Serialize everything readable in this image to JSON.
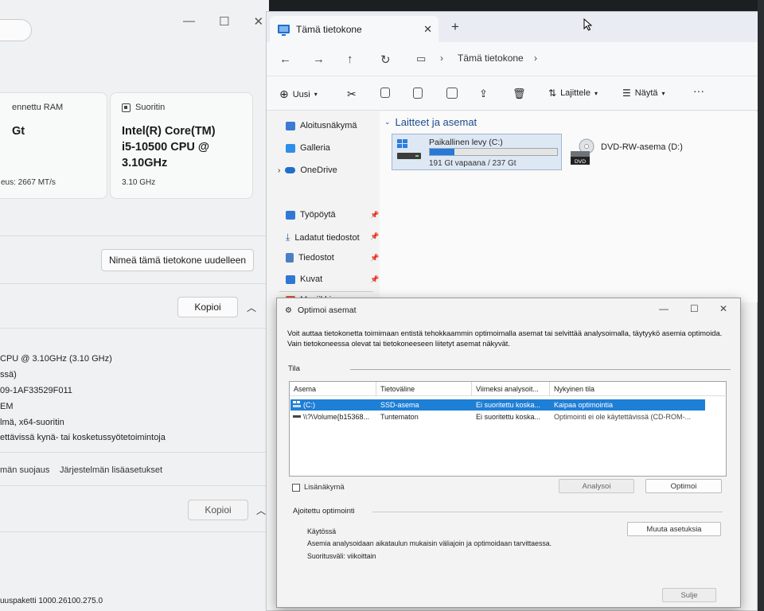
{
  "settings": {
    "ram_card": {
      "label": "ennettu RAM",
      "value": "Gt",
      "sub": "eus: 2667 MT/s"
    },
    "cpu_card": {
      "label": "Suoritin",
      "value_line1": "Intel(R) Core(TM)",
      "value_line2": "i5-10500 CPU @",
      "value_line3": "3.10GHz",
      "sub": "3.10 GHz"
    },
    "rename_button": "Nimeä tämä tietokone uudelleen",
    "copy_button": "Kopioi",
    "specs": [
      "CPU @ 3.10GHz (3.10 GHz)",
      "ssä)",
      "09-1AF33529F011",
      "EM",
      "lmä, x64-suoritin",
      "ettävissä kynä- tai kosketussyötetoimintoja"
    ],
    "links": {
      "protection": "män suojaus",
      "advanced": "Järjestelmän lisäasetukset"
    },
    "copy_button_2": "Kopioi",
    "footer": "uuspaketti 1000.26100.275.0"
  },
  "explorer": {
    "tab_title": "Tämä tietokone",
    "breadcrumb": "Tämä tietokone",
    "toolbar": {
      "new": "Uusi",
      "sort": "Lajittele",
      "view": "Näytä",
      "more": "···"
    },
    "nav": [
      {
        "label": "Aloitusnäkymä",
        "color": "#3a7bd5"
      },
      {
        "label": "Galleria",
        "color": "#2d8fe8"
      },
      {
        "label": "OneDrive",
        "color": "#1f6fcc"
      },
      {
        "label": "Työpöytä",
        "color": "#2f78d4"
      },
      {
        "label": "Ladatut tiedostot",
        "color": "#2a5aa0"
      },
      {
        "label": "Tiedostot",
        "color": "#4b7fc4"
      },
      {
        "label": "Kuvat",
        "color": "#2e78d1"
      },
      {
        "label": "Musiikki",
        "color": "#e0533b"
      }
    ],
    "group_title": "Laitteet ja asemat",
    "drive_c": {
      "name": "Paikallinen levy (C:)",
      "free": "191 Gt vapaana / 237 Gt",
      "used_fraction": 0.194
    },
    "drive_d": {
      "name": "DVD-RW-asema (D:)",
      "badge": "DVD"
    }
  },
  "optimize": {
    "title": "Optimoi asemat",
    "description": "Voit auttaa tietokonetta toimimaan entistä tehokkaammin optimoimalla asemat tai selvittää analysoimalla, täytyykö asemia optimoida. Vain tietokoneessa olevat tai tietokoneeseen liitetyt asemat näkyvät.",
    "status_label": "Tila",
    "columns": [
      "Asema",
      "Tietoväline",
      "Viimeksi analysoit...",
      "Nykyinen tila"
    ],
    "rows": [
      {
        "drive": "(C:)",
        "media": "SSD-asema",
        "last": "Ei suoritettu koska...",
        "state": "Kaipaa optimointia"
      },
      {
        "drive": "\\\\?\\Volume{b15368...",
        "media": "Tuntematon",
        "last": "Ei suoritettu koska...",
        "state": "Optimointi ei ole käytettävissä (CD-ROM-..."
      }
    ],
    "advanced_view": "Lisänäkymä",
    "analyze": "Analysoi",
    "optimize": "Optimoi",
    "scheduled_label": "Ajoitettu optimointi",
    "on_label": "Käytössä",
    "schedule_desc": "Asemia analysoidaan aikataulun mukaisin väliajoin ja optimoidaan tarvittaessa.",
    "frequency": "Suoritusväli: viikoittain",
    "change_settings": "Muuta asetuksia",
    "close": "Sulje"
  },
  "colors": {
    "accent": "#1e7fd6",
    "bar": "#2678dc",
    "explorer_bg": "#f3f3f3"
  }
}
